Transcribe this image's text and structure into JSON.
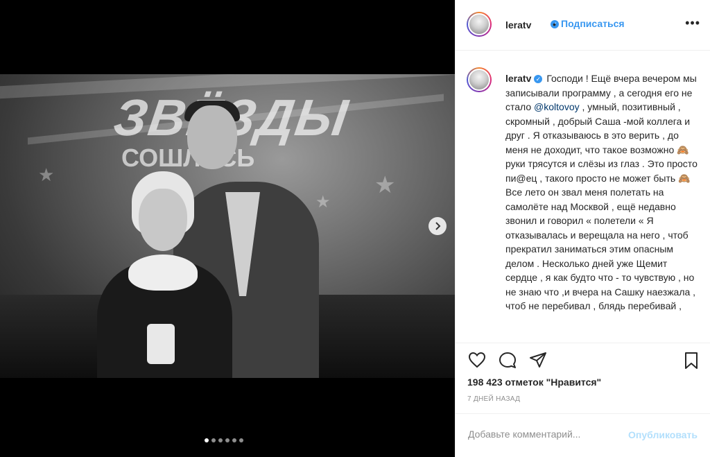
{
  "media": {
    "stage_title": "ЗВЁЗДЫ",
    "stage_subtitle": "СОШЛИСЬ",
    "next_icon": "chevron-right-icon",
    "carousel_count": 6,
    "carousel_active": 1
  },
  "header": {
    "username": "leratv",
    "verified_icon": "verified-badge-icon",
    "separator": "•",
    "follow_label": "Подписаться",
    "more_label": "•••"
  },
  "caption": {
    "username": "leratv",
    "text_1": "Господи ! Ещё вчера вечером мы записывали программу , а сегодня его не стало ",
    "mention": "@koltovoy",
    "text_2": " , умный, позитивный , скромный , добрый Саша -мой коллега и друг . Я отказываюсь в это верить , до меня не доходит, что такое возможно 🙈 руки трясутся и слёзы из глаз . Это просто пи@ец , такого просто не может быть 🙈 Все лето он звал меня полетать на самолёте над Москвой , ещё недавно звонил и говорил « полетели « Я отказывалась и верещала на него , чтоб прекратил заниматься этим опасным делом . Несколько дней уже Щемит сердце , я как будто что - то чувствую , но не знаю что ,и вчера на Сашку наезжала , чтоб не перебивал , блядь перебивай ,"
  },
  "actions": {
    "like_icon": "heart-icon",
    "comment_icon": "comment-icon",
    "share_icon": "share-icon",
    "save_icon": "bookmark-icon"
  },
  "likes_text": "198 423 отметок \"Нравится\"",
  "time_text": "7 ДНЕЙ НАЗАД",
  "comment": {
    "placeholder": "Добавьте комментарий...",
    "post_label": "Опубликовать"
  },
  "colors": {
    "accent": "#3897f0",
    "mention": "#00376b",
    "post_disabled": "#b2dffc"
  }
}
